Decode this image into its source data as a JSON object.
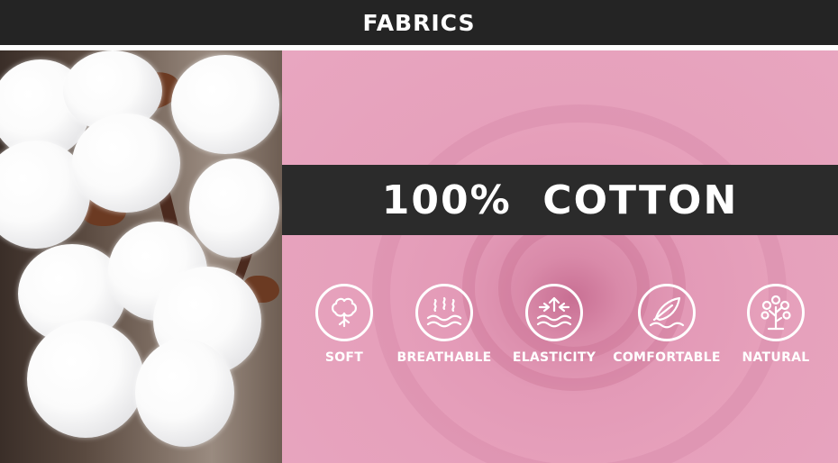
{
  "header": {
    "title": "FABRICS"
  },
  "banner": {
    "text": "100%  COTTON"
  },
  "features": [
    {
      "label": "SOFT",
      "icon": "cotton-boll-icon"
    },
    {
      "label": "BREATHABLE",
      "icon": "breathable-waves-icon"
    },
    {
      "label": "ELASTICITY",
      "icon": "elasticity-arrows-icon"
    },
    {
      "label": "COMFORTABLE",
      "icon": "feather-icon"
    },
    {
      "label": "NATURAL",
      "icon": "tree-icon"
    }
  ],
  "colors": {
    "header_bg": "#242424",
    "band_bg": "#2b2b2b",
    "fabric_pink": "#e6a0bb",
    "text": "#ffffff"
  }
}
